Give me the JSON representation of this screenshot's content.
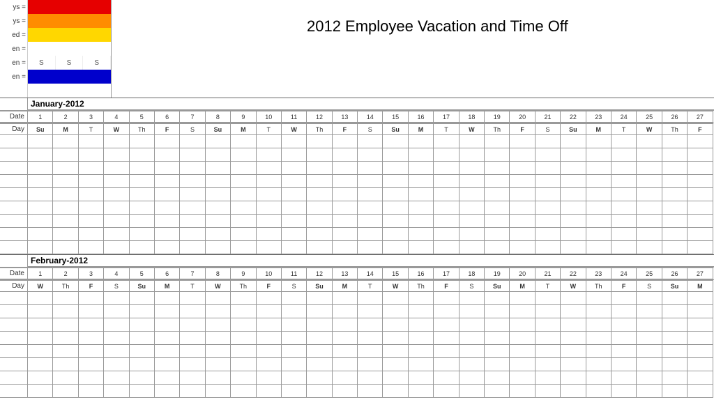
{
  "title": "2012 Employee Vacation and Time Off",
  "legend": {
    "rows": [
      {
        "label": "ys =",
        "colors": [
          "#e60000",
          "#e60000",
          "#e60000"
        ]
      },
      {
        "label": "ys =",
        "colors": [
          "#ff8c00",
          "#ff8c00",
          "#ff8c00"
        ]
      },
      {
        "label": "ed =",
        "colors": [
          "#ffd700",
          "#ffd700",
          "#ffd700"
        ]
      },
      {
        "label": "en =",
        "colors": [
          "#ffffff",
          "#ffffff",
          "#ffffff"
        ]
      },
      {
        "label": "en =",
        "colors": null,
        "s_labels": [
          "S",
          "S",
          "S"
        ]
      },
      {
        "label": "en =",
        "colors": [
          "#0000cc",
          "#0000cc",
          "#0000cc"
        ]
      }
    ]
  },
  "row_labels": {
    "date": "Date",
    "day": "Day"
  },
  "months": [
    {
      "name": "January-2012",
      "dates": [
        "1",
        "2",
        "3",
        "4",
        "5",
        "6",
        "7",
        "8",
        "9",
        "10",
        "11",
        "12",
        "13",
        "14",
        "15",
        "16",
        "17",
        "18",
        "19",
        "20",
        "21",
        "22",
        "23",
        "24",
        "25",
        "26",
        "27"
      ],
      "days": [
        "Su",
        "M",
        "T",
        "W",
        "Th",
        "F",
        "S",
        "Su",
        "M",
        "T",
        "W",
        "Th",
        "F",
        "S",
        "Su",
        "M",
        "T",
        "W",
        "Th",
        "F",
        "S",
        "Su",
        "M",
        "T",
        "W",
        "Th",
        "F"
      ],
      "body_rows": 9
    },
    {
      "name": "February-2012",
      "dates": [
        "1",
        "2",
        "3",
        "4",
        "5",
        "6",
        "7",
        "8",
        "9",
        "10",
        "11",
        "12",
        "13",
        "14",
        "15",
        "16",
        "17",
        "18",
        "19",
        "20",
        "21",
        "22",
        "23",
        "24",
        "25",
        "26",
        "27"
      ],
      "days": [
        "W",
        "Th",
        "F",
        "S",
        "Su",
        "M",
        "T",
        "W",
        "Th",
        "F",
        "S",
        "Su",
        "M",
        "T",
        "W",
        "Th",
        "F",
        "S",
        "Su",
        "M",
        "T",
        "W",
        "Th",
        "F",
        "S",
        "Su",
        "M"
      ],
      "body_rows": 8
    }
  ],
  "bold_days": [
    "Su",
    "M",
    "W",
    "F"
  ]
}
